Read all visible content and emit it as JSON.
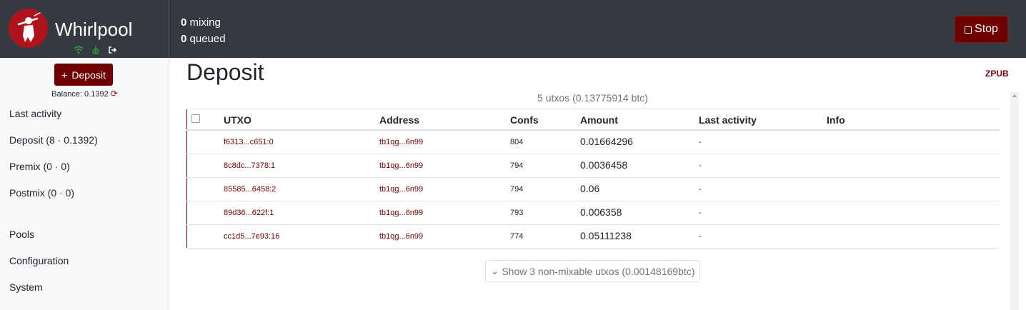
{
  "header": {
    "app_name": "Whirlpool",
    "mixing_count": "0",
    "mixing_label": "mixing",
    "queued_count": "0",
    "queued_label": "queued",
    "stop_label": "Stop",
    "brand_color": "#b0141a",
    "accent_color": "#6f0000"
  },
  "sidebar": {
    "deposit_button": "Deposit",
    "balance": "Balance: 0.1392",
    "items": [
      {
        "label": "Last activity"
      },
      {
        "label": "Deposit (8 · 0.1392)"
      },
      {
        "label": "Premix (0 · 0)"
      },
      {
        "label": "Postmix (0 · 0)"
      },
      {
        "label": "Pools"
      },
      {
        "label": "Configuration"
      },
      {
        "label": "System"
      }
    ]
  },
  "main": {
    "title": "Deposit",
    "zpub_link": "ZPUB",
    "summary": "5 utxos (0.13775914 btc)",
    "columns": [
      "UTXO",
      "Address",
      "Confs",
      "Amount",
      "Last activity",
      "Info"
    ],
    "rows": [
      {
        "utxo": "f6313...c651:0",
        "address": "tb1qg...6n99",
        "confs": "804",
        "amount": "0.01664296",
        "last_activity": "-",
        "info": ""
      },
      {
        "utxo": "8c8dc...7378:1",
        "address": "tb1qg...6n99",
        "confs": "794",
        "amount": "0.0036458",
        "last_activity": "-",
        "info": ""
      },
      {
        "utxo": "85585...6458:2",
        "address": "tb1qg...6n99",
        "confs": "794",
        "amount": "0.06",
        "last_activity": "-",
        "info": ""
      },
      {
        "utxo": "89d36...622f:1",
        "address": "tb1qg...6n99",
        "confs": "793",
        "amount": "0.006358",
        "last_activity": "-",
        "info": ""
      },
      {
        "utxo": "cc1d5...7e93:16",
        "address": "tb1qg...6n99",
        "confs": "774",
        "amount": "0.05111238",
        "last_activity": "-",
        "info": ""
      }
    ],
    "show_more": "Show 3 non-mixable utxos (0.00148169btc)"
  }
}
